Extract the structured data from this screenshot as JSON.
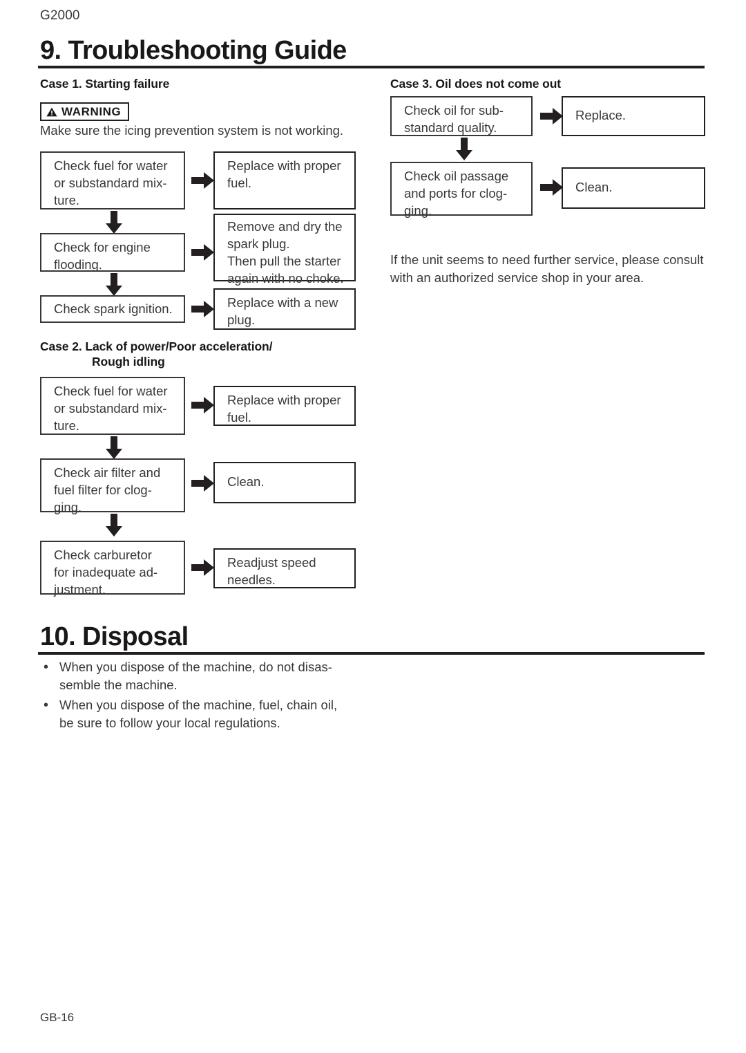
{
  "document": {
    "model_code": "G2000",
    "footer_page": "GB-16"
  },
  "sections": [
    {
      "number": "9.",
      "title": "9. Troubleshooting Guide"
    },
    {
      "number": "10.",
      "title": "10. Disposal"
    }
  ],
  "case1": {
    "heading": "Case 1.  Starting failure",
    "warning": {
      "label": "WARNING",
      "icon": "warning-triangle-icon",
      "body": "Make sure the icing prevention system is not working."
    },
    "steps": [
      {
        "check": [
          "Check fuel for water",
          "or substandard mix-",
          "ture."
        ],
        "action": [
          "Replace with proper",
          "fuel."
        ]
      },
      {
        "check": [
          "Check for engine",
          "flooding."
        ],
        "action": [
          "Remove and dry the",
          "spark plug.",
          "Then pull the starter",
          "again with no choke."
        ]
      },
      {
        "check": [
          "Check spark ignition."
        ],
        "action": [
          "Replace with a new",
          "plug."
        ]
      }
    ]
  },
  "case2": {
    "heading_line1": "Case 2.  Lack of power/Poor acceleration/",
    "heading_line2": "Rough idling",
    "steps": [
      {
        "check": [
          "Check fuel for water",
          "or substandard mix-",
          "ture."
        ],
        "action": [
          "Replace with proper",
          "fuel."
        ]
      },
      {
        "check": [
          "Check air filter and",
          "fuel filter for clog-",
          "ging."
        ],
        "action": [
          "Clean."
        ]
      },
      {
        "check": [
          "Check carburetor",
          "for inadequate ad-",
          "justment."
        ],
        "action": [
          "Readjust speed",
          "needles."
        ]
      }
    ]
  },
  "case3": {
    "heading": "Case 3.  Oil does not come out",
    "steps": [
      {
        "check": [
          "Check oil for sub-",
          "standard quality."
        ],
        "action": [
          "Replace."
        ]
      },
      {
        "check": [
          "Check oil passage",
          "and ports for clog-",
          "ging."
        ],
        "action": [
          "Clean."
        ]
      }
    ],
    "note": [
      "If the unit seems to need further service, please consult",
      "with an authorized service shop in your area."
    ]
  },
  "disposal": {
    "bullets": [
      {
        "marker": "•",
        "lines": [
          "When you dispose of the machine, do not disas-",
          "semble the machine."
        ]
      },
      {
        "marker": "•",
        "lines": [
          "When you dispose of the machine, fuel, chain oil,",
          "be sure to follow your local regulations."
        ]
      }
    ]
  },
  "colors": {
    "ink": "#231f20",
    "body_text": "#3b3738",
    "box_border": "#3a3537",
    "paper": "#ffffff"
  }
}
